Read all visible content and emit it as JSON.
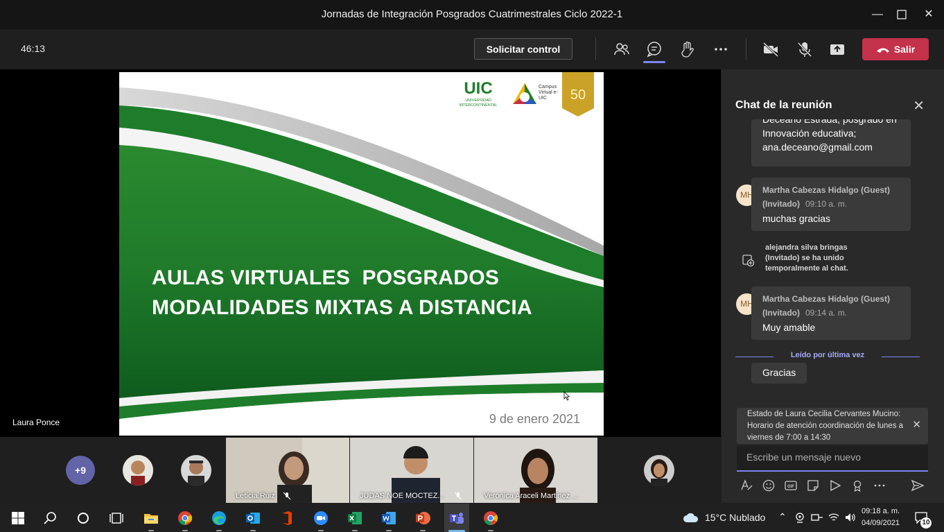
{
  "window": {
    "title": "Jornadas de Integración Posgrados Cuatrimestrales Ciclo 2022-1",
    "controls": [
      "minimize-icon",
      "maximize-icon",
      "close-icon"
    ]
  },
  "meeting_bar": {
    "timer": "46:13",
    "request_control_label": "Solicitar control",
    "leave_label": "Salir",
    "icons": [
      "participants-icon",
      "chat-icon",
      "raise-hand-icon",
      "more-icon",
      "camera-off-icon",
      "mic-off-icon",
      "share-icon",
      "phone-hangup-icon"
    ]
  },
  "stage": {
    "slide": {
      "logo_text_1": "UIC",
      "logo_text_2": "UNIVERSIDAD INTERCONTINENTAL",
      "logo_text_3": "Campus Virtual e-UIC",
      "logo_badge": "50",
      "title_line_1": "AULAS VIRTUALES  POSGRADOS",
      "title_line_2": "MODALIDADES MIXTAS A DISTANCIA",
      "date": "9 de enero 2021"
    },
    "presenter_name": "Laura Ponce"
  },
  "chat": {
    "header": "Chat de la reunión",
    "messages": [
      {
        "text_lines": [
          "Deceano Estrada, posgrado en",
          "Innovación educativa;",
          "ana.deceano@gmail.com"
        ]
      },
      {
        "initials": "MH",
        "sender": "Martha Cabezas Hidalgo (Guest)",
        "sender_suffix": "(Invitado)",
        "time": "09:10 a. m.",
        "text": "muchas gracias"
      },
      {
        "system": "alejandra silva bringas (Invitado) se ha unido temporalmente al chat."
      },
      {
        "initials": "MH",
        "sender": "Martha Cabezas Hidalgo (Guest)",
        "sender_suffix": "(Invitado)",
        "time": "09:14 a. m.",
        "text": "Muy amable"
      },
      {
        "text": "Gracias"
      }
    ],
    "last_read_label": "Leído por última vez",
    "status_banner": "Estado de Laura Cecilia Cervantes Mucino: Horario de atención coordinación de lunes a viernes de 7:00 a 14:30",
    "composer_placeholder": "Escribe un mensaje nuevo",
    "composer_icons": [
      "format-icon",
      "emoji-icon",
      "gif-icon",
      "sticker-icon",
      "meet-now-icon",
      "praise-icon",
      "more-options-icon",
      "send-icon"
    ]
  },
  "gallery": {
    "overflow_count": "+9",
    "tiles": [
      {
        "name": "Leticia Ruiz",
        "muted": true
      },
      {
        "name": "JUDAS NOE MOCTEZ...",
        "muted": true
      },
      {
        "name": "Veronica Araceli Martinez ...",
        "muted": false
      }
    ]
  },
  "taskbar": {
    "apps": [
      "windows-start-icon",
      "search-icon",
      "cortana-icon",
      "task-view-icon",
      "file-explorer-icon",
      "chrome-icon",
      "edge-icon",
      "outlook-icon",
      "office-icon",
      "zoom-icon",
      "excel-icon",
      "word-icon",
      "powerpoint-icon",
      "teams-icon",
      "chrome-alt-icon"
    ],
    "weather": "15°C  Nublado",
    "time": "09:18 a. m.",
    "date": "04/09/2021",
    "notifications": "10"
  }
}
